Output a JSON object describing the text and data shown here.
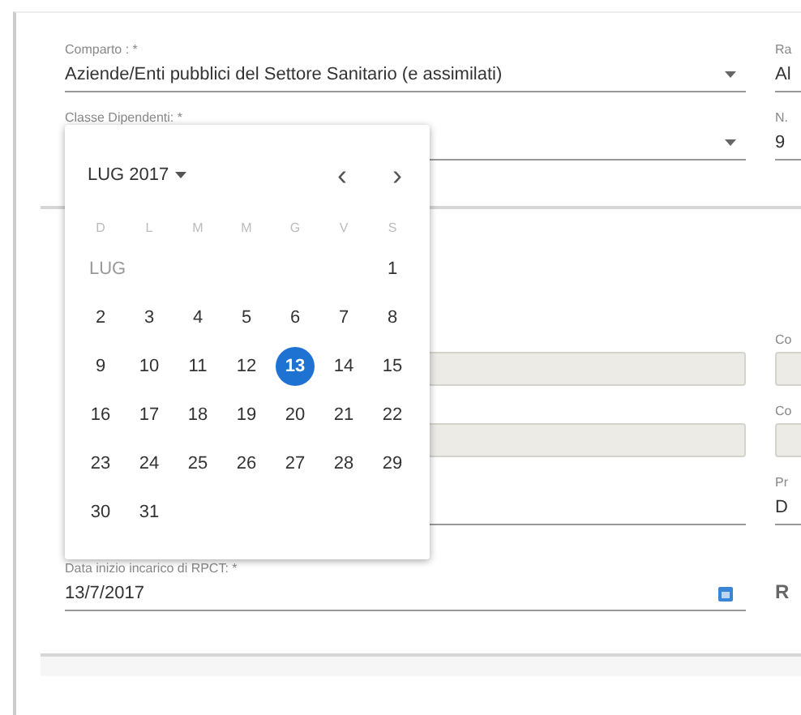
{
  "sections": [
    {
      "rows": [
        {
          "left": {
            "kind": "select",
            "label": "Comparto : *",
            "value": "Aziende/Enti pubblici del Settore Sanitario (e assimilati)"
          },
          "right": {
            "kind": "text",
            "label": "Ra",
            "value": "Al"
          }
        },
        {
          "left": {
            "kind": "select",
            "label": "Classe Dipendenti: *"
          },
          "right": {
            "kind": "text",
            "label": "N.",
            "value": "9"
          }
        }
      ]
    },
    {
      "rows": [
        {
          "left": {
            "kind": "disabled"
          },
          "right": {
            "kind": "disabled",
            "label": "Co"
          }
        },
        {
          "left": {
            "kind": "disabled"
          },
          "right": {
            "kind": "disabled",
            "label": "Co"
          }
        },
        {
          "left": {
            "kind": "text"
          },
          "right": {
            "kind": "text",
            "label": "Pr",
            "value": "D"
          }
        },
        {
          "left": {
            "kind": "date",
            "label": "Data inizio incarico di RPCT: *",
            "value": "13/7/2017"
          },
          "right": {
            "kind": "plain",
            "value": "R"
          }
        }
      ]
    }
  ],
  "calendar": {
    "month": "LUG 2017",
    "prev": "‹",
    "next": "›",
    "weekdays": [
      "D",
      "L",
      "M",
      "M",
      "G",
      "V",
      "S"
    ],
    "month_short": "LUG",
    "weeks": [
      {
        "days": [
          {
            "label": "1",
            "selected": false
          }
        ]
      },
      {
        "days": [
          {
            "label": "2",
            "selected": false
          },
          {
            "label": "3",
            "selected": false
          },
          {
            "label": "4",
            "selected": false
          },
          {
            "label": "5",
            "selected": false
          },
          {
            "label": "6",
            "selected": false
          },
          {
            "label": "7",
            "selected": false
          },
          {
            "label": "8",
            "selected": false
          }
        ]
      },
      {
        "days": [
          {
            "label": "9",
            "selected": false
          },
          {
            "label": "10",
            "selected": false
          },
          {
            "label": "11",
            "selected": false
          },
          {
            "label": "12",
            "selected": false
          },
          {
            "label": "13",
            "selected": true
          },
          {
            "label": "14",
            "selected": false
          },
          {
            "label": "15",
            "selected": false
          }
        ]
      },
      {
        "days": [
          {
            "label": "16",
            "selected": false
          },
          {
            "label": "17",
            "selected": false
          },
          {
            "label": "18",
            "selected": false
          },
          {
            "label": "19",
            "selected": false
          },
          {
            "label": "20",
            "selected": false
          },
          {
            "label": "21",
            "selected": false
          },
          {
            "label": "22",
            "selected": false
          }
        ]
      },
      {
        "days": [
          {
            "label": "23",
            "selected": false
          },
          {
            "label": "24",
            "selected": false
          },
          {
            "label": "25",
            "selected": false
          },
          {
            "label": "26",
            "selected": false
          },
          {
            "label": "27",
            "selected": false
          },
          {
            "label": "28",
            "selected": false
          },
          {
            "label": "29",
            "selected": false
          }
        ]
      },
      {
        "days": [
          {
            "label": "30",
            "selected": false
          },
          {
            "label": "31",
            "selected": false
          }
        ]
      }
    ]
  }
}
